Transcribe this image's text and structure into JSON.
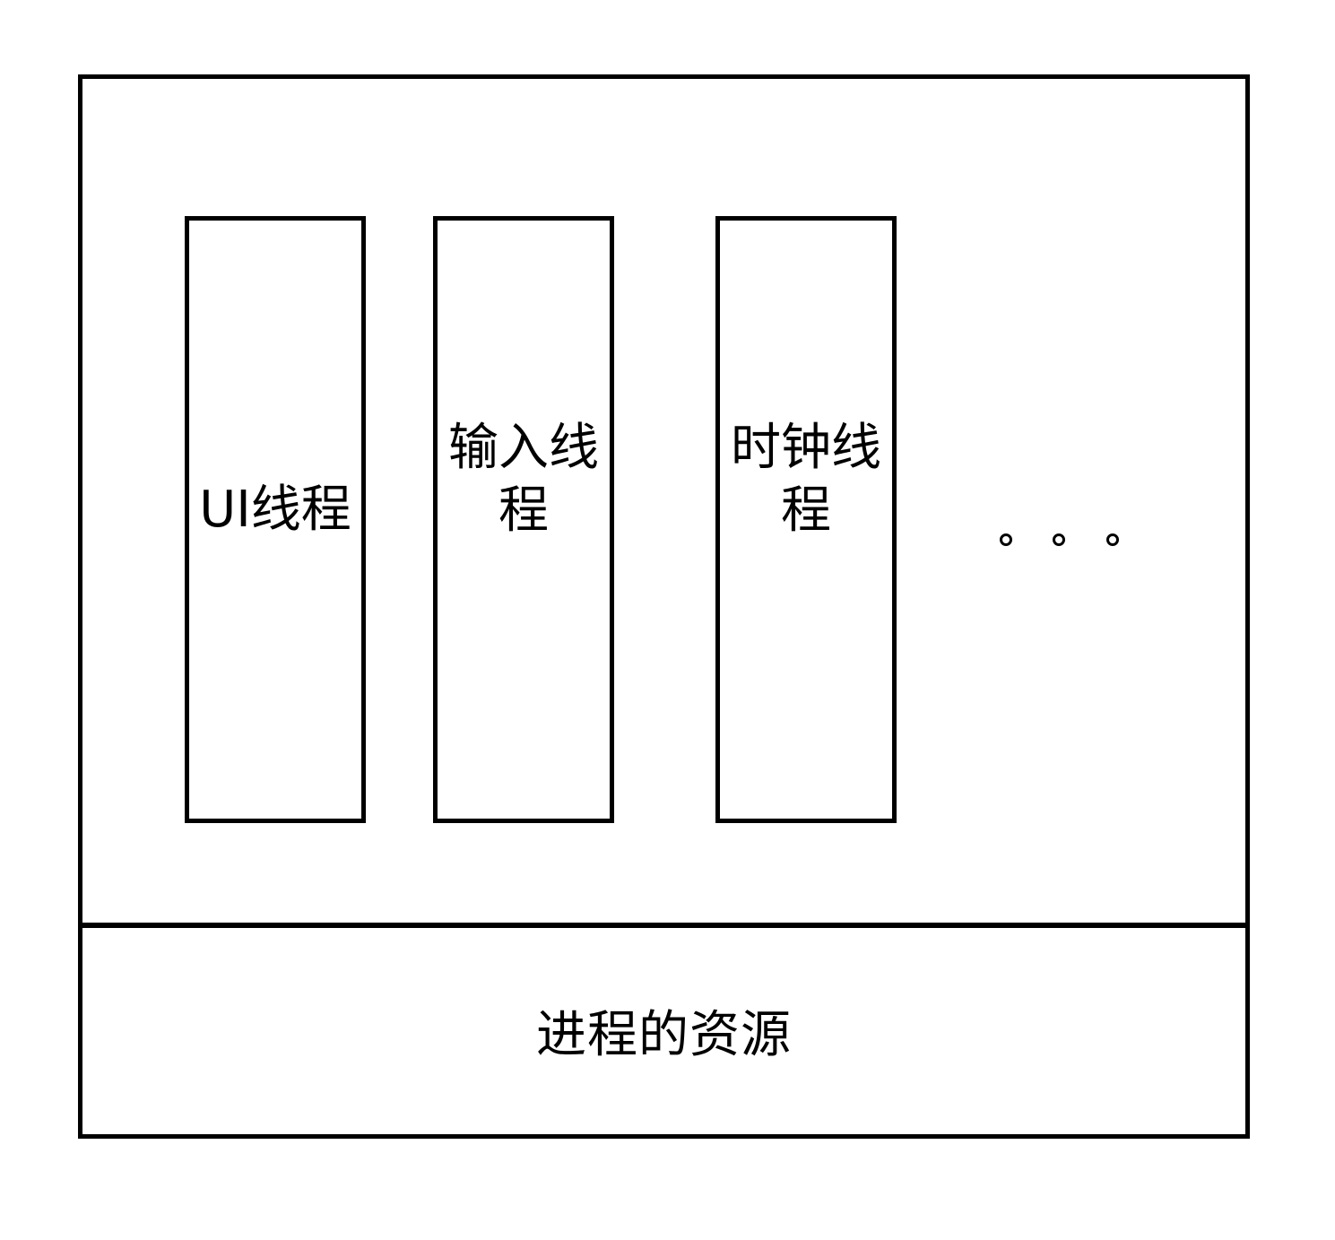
{
  "diagram": {
    "threads": [
      {
        "label": "UI线程"
      },
      {
        "label": "输入线程"
      },
      {
        "label": "时钟线程"
      }
    ],
    "more_indicator": "。。。",
    "resources_label": "进程的资源"
  }
}
